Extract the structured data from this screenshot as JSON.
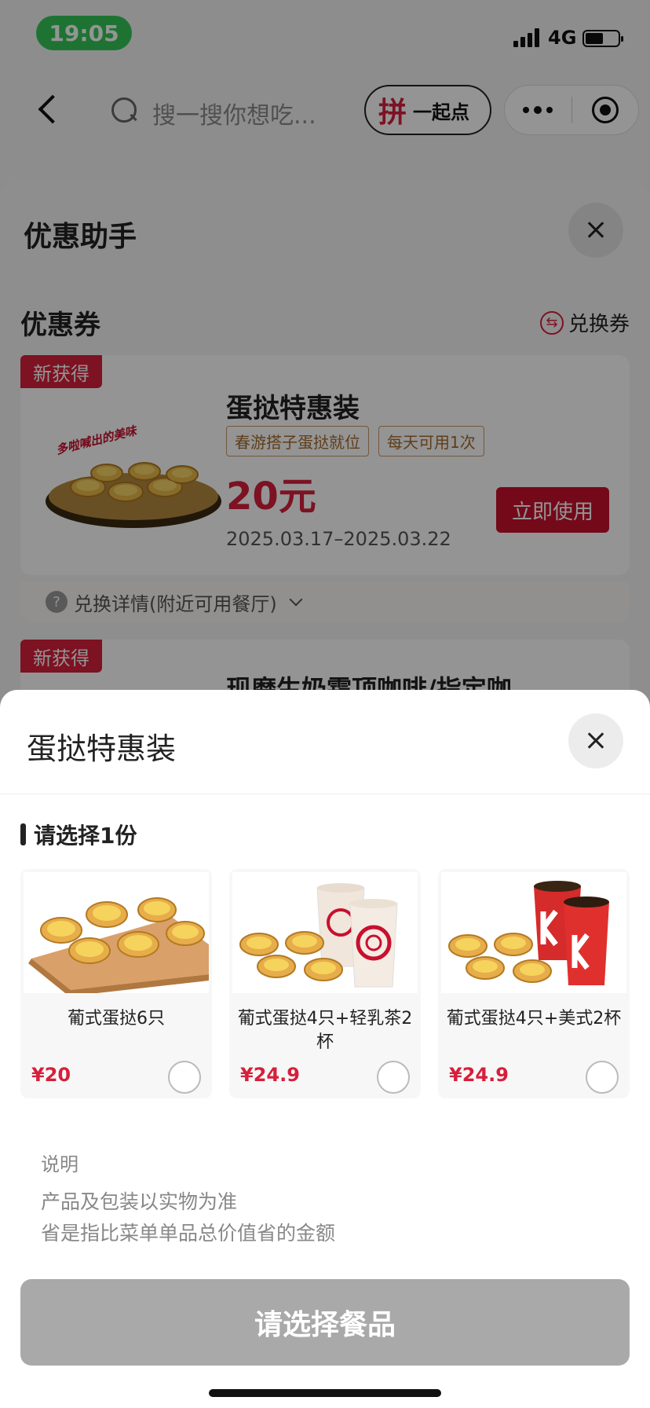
{
  "status_bar": {
    "time": "19:05",
    "network": "4G",
    "battery_level": 0.55
  },
  "nav": {
    "search_placeholder": "搜一搜你想吃...",
    "group_icon_glyph": "拼",
    "group_label": "一起点"
  },
  "coupon_panel": {
    "title": "优惠助手",
    "section_title": "优惠券",
    "exchange_label": "兑换券",
    "exchange_icon_glyph": "⇆",
    "cards": [
      {
        "new_tag": "新获得",
        "name": "蛋挞特惠装",
        "tags": [
          "春游搭子蛋挞就位",
          "每天可用1次"
        ],
        "price": "20元",
        "date_range": "2025.03.17–2025.03.22",
        "use_label": "立即使用",
        "detail_label": "兑换详情(附近可用餐厅)",
        "detail_icon_glyph": "?",
        "plate_text": "多啦喊出的美味"
      },
      {
        "new_tag": "新获得",
        "name": "现磨生奶霜顶咖啡/指定咖"
      }
    ]
  },
  "sheet": {
    "title": "蛋挞特惠装",
    "select_prompt": "请选择1份",
    "options": [
      {
        "name": "葡式蛋挞6只",
        "price": "¥20",
        "image": "egg-tarts-6"
      },
      {
        "name": "葡式蛋挞4只+轻乳茶2杯",
        "price": "¥24.9",
        "image": "egg-tarts-milk-tea"
      },
      {
        "name": "葡式蛋挞4只+美式2杯",
        "price": "¥24.9",
        "image": "egg-tarts-americano"
      }
    ],
    "note_label": "说明",
    "notes": [
      "产品及包装以实物为准",
      "省是指比菜单单品总价值省的金额"
    ],
    "cta_label": "请选择餐品"
  },
  "colors": {
    "brand_red": "#d61f3b",
    "cta_disabled": "#a9a9a9",
    "time_pill": "#35c759"
  }
}
